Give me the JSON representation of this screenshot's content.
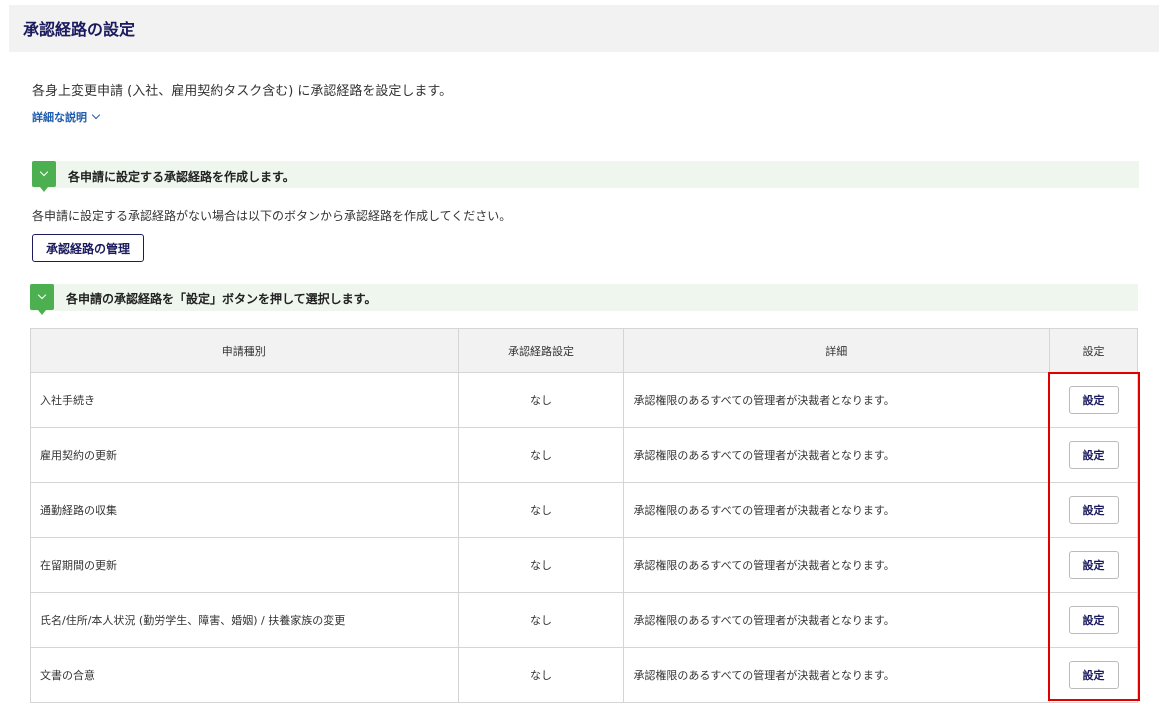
{
  "page": {
    "title": "承認経路の設定",
    "description": "各身上変更申請 (入社、雇用契約タスク含む) に承認経路を設定します。",
    "detail_link": "詳細な説明"
  },
  "section1": {
    "title": "各申請に設定する承認経路を作成します。",
    "text": "各申請に設定する承認経路がない場合は以下のボタンから承認経路を作成してください。",
    "button": "承認経路の管理"
  },
  "section2": {
    "title": "各申請の承認経路を「設定」ボタンを押して選択します。"
  },
  "table": {
    "headers": [
      "申請種別",
      "承認経路設定",
      "詳細",
      "設定"
    ],
    "rows": [
      {
        "type": "入社手続き",
        "route": "なし",
        "detail": "承認権限のあるすべての管理者が決裁者となります。",
        "button": "設定"
      },
      {
        "type": "雇用契約の更新",
        "route": "なし",
        "detail": "承認権限のあるすべての管理者が決裁者となります。",
        "button": "設定"
      },
      {
        "type": "通勤経路の収集",
        "route": "なし",
        "detail": "承認権限のあるすべての管理者が決裁者となります。",
        "button": "設定"
      },
      {
        "type": "在留期間の更新",
        "route": "なし",
        "detail": "承認権限のあるすべての管理者が決裁者となります。",
        "button": "設定"
      },
      {
        "type": "氏名/住所/本人状況 (勤労学生、障害、婚姻) / 扶養家族の変更",
        "route": "なし",
        "detail": "承認権限のあるすべての管理者が決裁者となります。",
        "button": "設定"
      },
      {
        "type": "文書の合意",
        "route": "なし",
        "detail": "承認権限のあるすべての管理者が決裁者となります。",
        "button": "設定"
      }
    ]
  },
  "colors": {
    "accent_green": "#4caf50",
    "navy": "#1a1a5e",
    "link_blue": "#1f5cad",
    "highlight_red": "#e00000"
  }
}
